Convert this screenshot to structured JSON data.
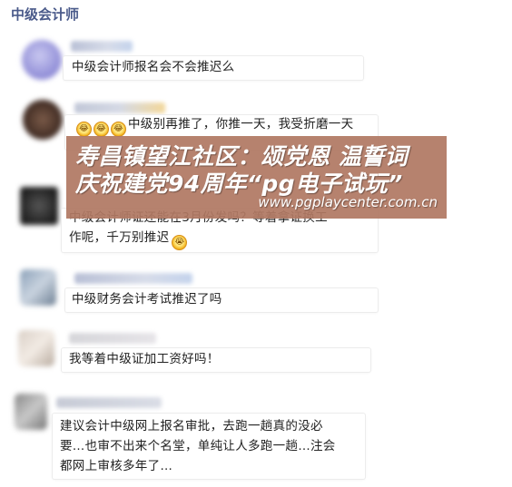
{
  "header": {
    "title": "中级会计师"
  },
  "comments": [
    {
      "text": "中级会计师报名会不会推迟么"
    },
    {
      "emojis": [
        "😂",
        "😂",
        "😂"
      ],
      "text": "中级别再推了，你推一天，我受折磨一天"
    },
    {
      "line1": "中级会计师证还能在3月份发吗？等着拿证换工",
      "line2": "作呢，千万别推迟",
      "emoji": "😭"
    },
    {
      "text": "中级财务会计考试推迟了吗"
    },
    {
      "text": "我等着中级证加工资好吗！"
    },
    {
      "line1": "建议会计中级网上报名审批，去跑一趟真的没必",
      "line2": "要…也审不出来个名堂，单纯让人多跑一趟…注会",
      "line3": "都网上审核多年了…"
    }
  ],
  "overlay": {
    "title_line1": "寿昌镇望江社区：颂党恩 温誓词",
    "title_line2": "庆祝建党94周年“pg电子试玩”",
    "url": "www.pgplaycenter.com.cn"
  },
  "colors": {
    "heading": "#4a5a8a",
    "overlay": "#b07863"
  }
}
